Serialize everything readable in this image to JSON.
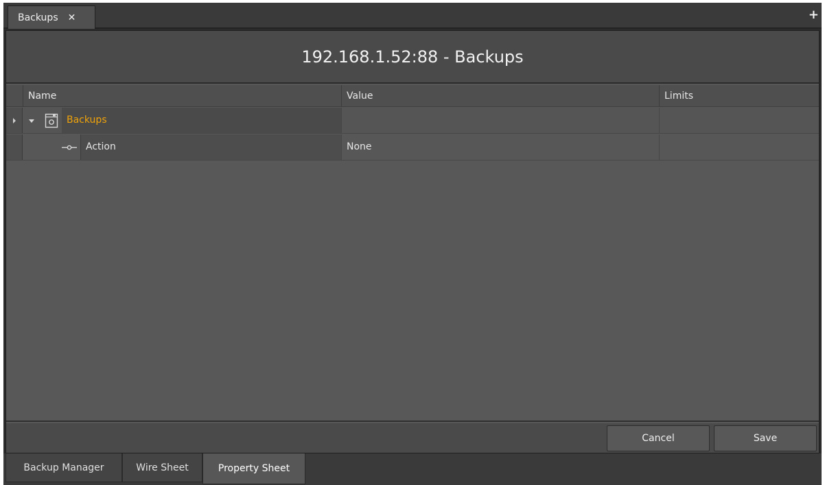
{
  "doc_tab": {
    "label": "Backups",
    "close_glyph": "✕"
  },
  "add_tab_glyph": "+",
  "title": "192.168.1.52:88 - Backups",
  "grid": {
    "columns": [
      "Name",
      "Value",
      "Limits"
    ],
    "rows": [
      {
        "name": "Backups",
        "value": "",
        "limits": "",
        "icon": "backup-folder-icon",
        "color": "#f0a30a"
      },
      {
        "name": "Action",
        "value": "None",
        "limits": "",
        "icon": "action-slot-icon"
      }
    ]
  },
  "footer": {
    "cancel_label": "Cancel",
    "save_label": "Save"
  },
  "view_tabs": [
    "Backup Manager",
    "Wire Sheet",
    "Property Sheet"
  ],
  "active_view_tab": "Property Sheet"
}
